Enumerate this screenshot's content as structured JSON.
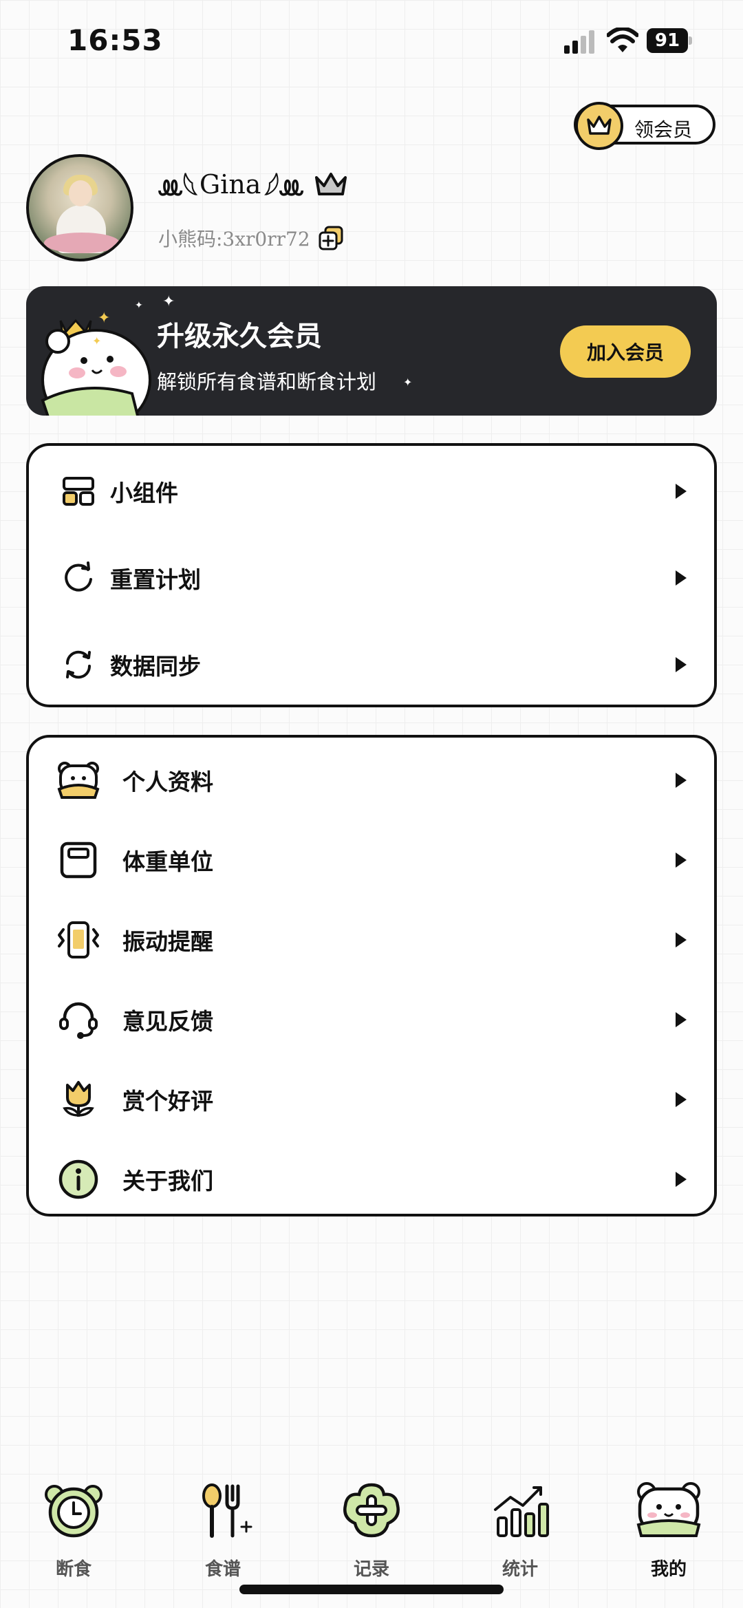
{
  "status_bar": {
    "time": "16:53",
    "battery": "91"
  },
  "vip_pill": {
    "label": "领会员"
  },
  "profile": {
    "name_left_deco": "ꔛ𓆩",
    "name": "Gina",
    "name_right_deco": "𓆪ꔛ",
    "code": "小熊码:3xr0rr72"
  },
  "banner": {
    "title": "升级永久会员",
    "subtitle": "解锁所有食谱和断食计划",
    "button": "加入会员"
  },
  "menu_group_1": [
    {
      "label": "小组件",
      "icon": "widget-icon"
    },
    {
      "label": "重置计划",
      "icon": "reset-icon"
    },
    {
      "label": "数据同步",
      "icon": "sync-icon"
    }
  ],
  "menu_group_2": [
    {
      "label": "个人资料",
      "icon": "bear-profile-icon"
    },
    {
      "label": "体重单位",
      "icon": "scale-icon"
    },
    {
      "label": "振动提醒",
      "icon": "vibrate-icon"
    },
    {
      "label": "意见反馈",
      "icon": "headset-icon"
    },
    {
      "label": "赏个好评",
      "icon": "tulip-icon"
    },
    {
      "label": "关于我们",
      "icon": "info-icon"
    }
  ],
  "bottom_nav": [
    {
      "label": "断食",
      "icon": "clock-icon"
    },
    {
      "label": "食谱",
      "icon": "utensils-icon"
    },
    {
      "label": "记录",
      "icon": "add-record-icon"
    },
    {
      "label": "统计",
      "icon": "chart-icon"
    },
    {
      "label": "我的",
      "icon": "bear-icon",
      "active": true
    }
  ],
  "colors": {
    "accent_yellow": "#f3cb52",
    "banner_bg": "#26272b",
    "green": "#cfe7a8"
  }
}
